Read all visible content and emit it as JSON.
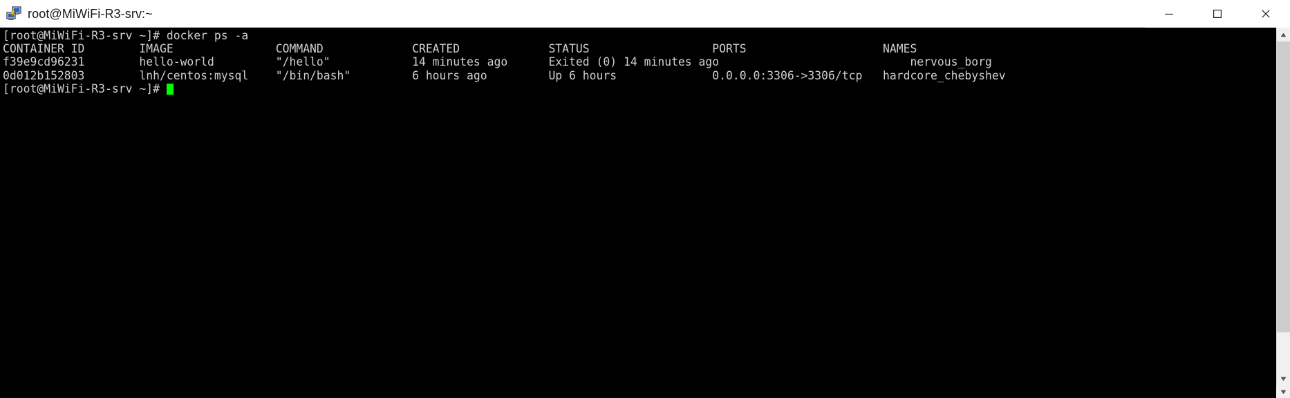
{
  "window": {
    "title": "root@MiWiFi-R3-srv:~",
    "app_icon": "putty-computer-icon",
    "controls": {
      "minimize_label": "Minimize",
      "maximize_label": "Maximize",
      "close_label": "Close"
    }
  },
  "terminal": {
    "prompt": "[root@MiWiFi-R3-srv ~]#",
    "command": "docker ps -a",
    "command_line": "[root@MiWiFi-R3-srv ~]# docker ps -a",
    "columns": [
      "CONTAINER ID",
      "IMAGE",
      "COMMAND",
      "CREATED",
      "STATUS",
      "PORTS",
      "NAMES"
    ],
    "header_line": "CONTAINER ID        IMAGE               COMMAND             CREATED             STATUS                  PORTS                    NAMES",
    "rows": [
      {
        "container_id": "f39e9cd96231",
        "image": "hello-world",
        "command": "\"/hello\"",
        "created": "14 minutes ago",
        "status": "Exited (0) 14 minutes ago",
        "ports": "",
        "names": "nervous_borg",
        "line": "f39e9cd96231        hello-world         \"/hello\"            14 minutes ago      Exited (0) 14 minutes ago                            nervous_borg"
      },
      {
        "container_id": "0d012b152803",
        "image": "lnh/centos:mysql",
        "command": "\"/bin/bash\"",
        "created": "6 hours ago",
        "status": "Up 6 hours",
        "ports": "0.0.0.0:3306->3306/tcp",
        "names": "hardcore_chebyshev",
        "line": "0d012b152803        lnh/centos:mysql    \"/bin/bash\"         6 hours ago         Up 6 hours              0.0.0.0:3306->3306/tcp   hardcore_chebyshev"
      }
    ],
    "final_prompt": "[root@MiWiFi-R3-srv ~]# ",
    "cursor": "block-cursor"
  },
  "scrollbar": {
    "up_arrow": "scroll-up-arrow",
    "down_arrow": "scroll-down-arrow"
  },
  "colors": {
    "terminal_background": "#000000",
    "terminal_foreground": "#cfcfcf",
    "cursor": "#00ff00",
    "titlebar_background": "#ffffff",
    "title_foreground": "#1a1a1a"
  }
}
